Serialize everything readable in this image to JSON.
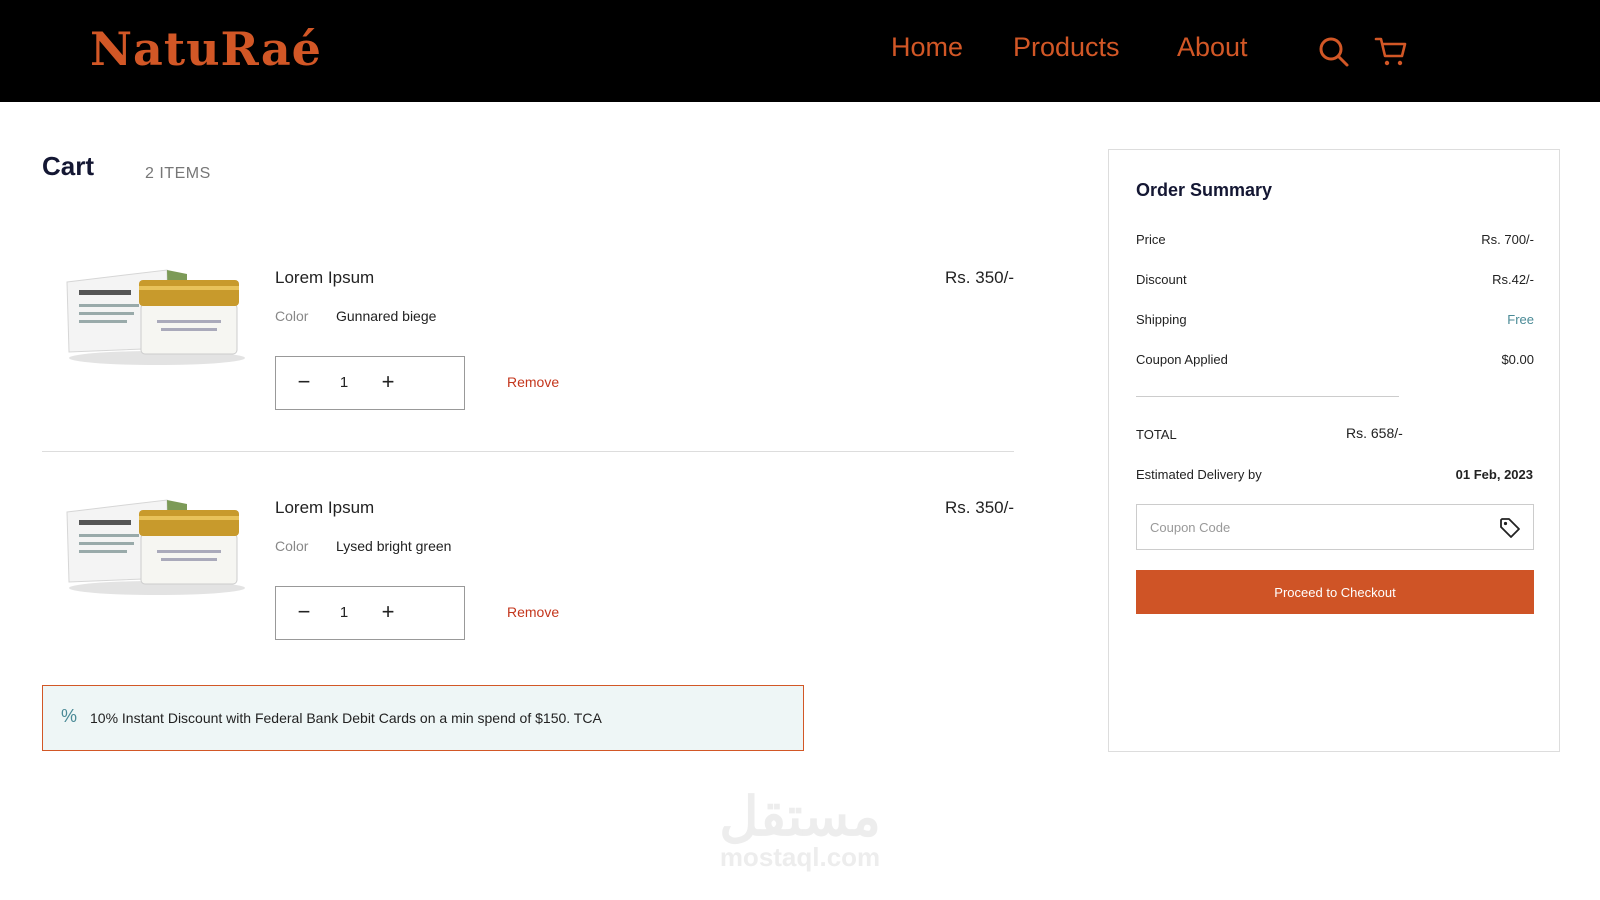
{
  "brand": {
    "logo": "NatuRaé",
    "accent": "#d25726"
  },
  "nav": {
    "home": "Home",
    "products": "Products",
    "about": "About"
  },
  "icons": {
    "search": "search-icon",
    "cart": "cart-icon",
    "tag": "tag-icon",
    "percent": "percent-icon"
  },
  "cart": {
    "title": "Cart",
    "count": "2 ITEMS",
    "items": [
      {
        "name": "Lorem Ipsum",
        "price": "Rs. 350/-",
        "color_label": "Color",
        "color_value": "Gunnared biege",
        "qty": "1",
        "minus": "−",
        "plus": "+",
        "remove": "Remove"
      },
      {
        "name": "Lorem Ipsum",
        "price": "Rs. 350/-",
        "color_label": "Color",
        "color_value": "Lysed bright green",
        "qty": "1",
        "minus": "−",
        "plus": "+",
        "remove": "Remove"
      }
    ]
  },
  "promo": {
    "icon": "%",
    "text": "10% Instant Discount with Federal Bank Debit Cards on a min spend of $150. TCA"
  },
  "summary": {
    "title": "Order Summary",
    "rows": [
      {
        "label": "Price",
        "value": "Rs. 700/-"
      },
      {
        "label": "Discount",
        "value": "Rs.42/-"
      },
      {
        "label": "Shipping",
        "value": "Free"
      },
      {
        "label": "Coupon Applied",
        "value": "$0.00"
      }
    ],
    "total_label": "TOTAL",
    "total_value": "Rs. 658/-",
    "eta_label": "Estimated Delivery by",
    "eta_value": "01 Feb, 2023",
    "coupon_placeholder": "Coupon Code",
    "checkout_label": "Proceed to Checkout"
  },
  "watermark": {
    "arabic": "مستقل",
    "latin": "mostaql.com"
  }
}
